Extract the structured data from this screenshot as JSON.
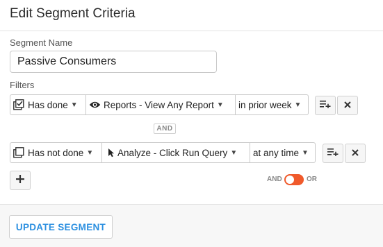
{
  "header": {
    "title": "Edit Segment Criteria"
  },
  "segment_name": {
    "label": "Segment Name",
    "value": "Passive Consumers"
  },
  "filters": {
    "label": "Filters",
    "rows": [
      {
        "condition": "Has done",
        "condition_icon": "checked-box-icon",
        "event": "Reports - View Any Report",
        "event_icon": "eye-icon",
        "timeframe": "in prior week"
      },
      {
        "condition": "Has not done",
        "condition_icon": "unchecked-box-icon",
        "event": "Analyze - Click Run Query",
        "event_icon": "cursor-icon",
        "timeframe": "at any time"
      }
    ],
    "joiner": "AND"
  },
  "logic_toggle": {
    "and_label": "AND",
    "or_label": "OR",
    "selected": "OR",
    "accent_color": "#f05a2b"
  },
  "footer": {
    "update_label": "UPDATE SEGMENT",
    "accent_color": "#2b8fe0"
  }
}
